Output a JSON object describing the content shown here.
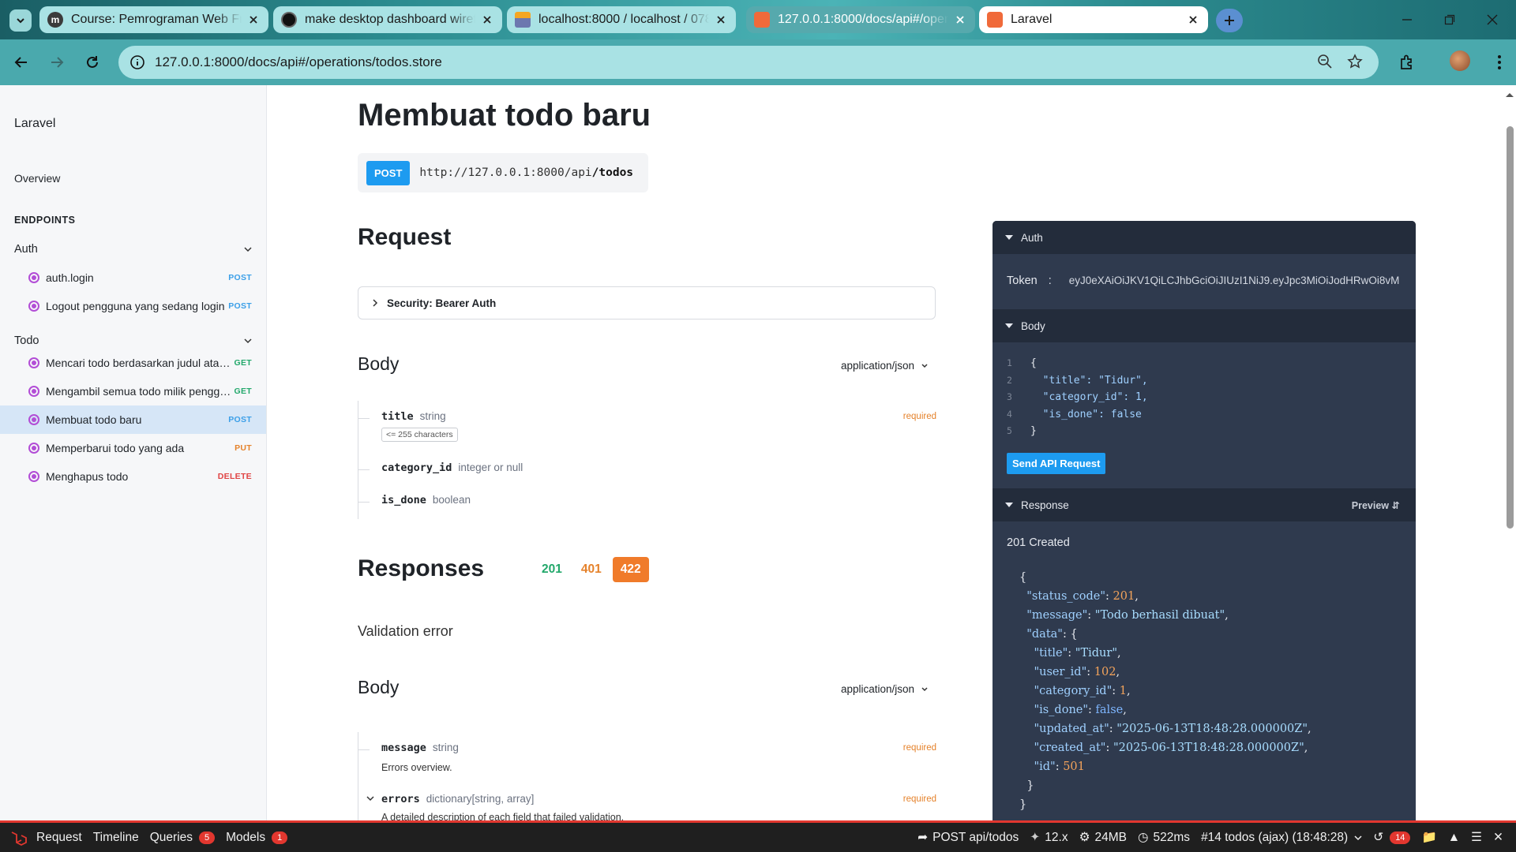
{
  "browser": {
    "tabs": [
      {
        "title": "Course: Pemrograman Web Fra",
        "favicon": "moodle-icon"
      },
      {
        "title": "make desktop dashboard wiref",
        "favicon": "chatgpt-icon"
      },
      {
        "title": "localhost:8000 / localhost / 078",
        "favicon": "phpmyadmin-icon"
      },
      {
        "title": "127.0.0.1:8000/docs/api#/opera",
        "favicon": "laravel-icon"
      },
      {
        "title": "Laravel",
        "favicon": "laravel-icon"
      }
    ],
    "url": "127.0.0.1:8000/docs/api#/operations/todos.store"
  },
  "sidebar": {
    "brand": "Laravel",
    "overview": "Overview",
    "endpoints_heading": "ENDPOINTS",
    "groups": [
      {
        "name": "Auth",
        "items": [
          {
            "label": "auth.login",
            "method": "POST"
          },
          {
            "label": "Logout pengguna yang sedang login",
            "method": "POST"
          }
        ]
      },
      {
        "name": "Todo",
        "items": [
          {
            "label": "Mencari todo berdasarkan judul atau ...",
            "method": "GET"
          },
          {
            "label": "Mengambil semua todo milik penggu...",
            "method": "GET"
          },
          {
            "label": "Membuat todo baru",
            "method": "POST"
          },
          {
            "label": "Memperbarui todo yang ada",
            "method": "PUT"
          },
          {
            "label": "Menghapus todo",
            "method": "DELETE"
          }
        ]
      }
    ]
  },
  "main": {
    "title": "Membuat todo baru",
    "method": "POST",
    "url_base": "http://127.0.0.1:8000/api",
    "url_path": "/todos",
    "request_heading": "Request",
    "security": "Security: Bearer Auth",
    "body_heading": "Body",
    "content_type": "application/json",
    "request_fields": [
      {
        "name": "title",
        "type": "string",
        "required": "required",
        "constraint": "<= 255 characters"
      },
      {
        "name": "category_id",
        "type": "integer or null"
      },
      {
        "name": "is_done",
        "type": "boolean"
      }
    ],
    "responses_heading": "Responses",
    "response_codes": [
      "201",
      "401",
      "422"
    ],
    "response_desc": "Validation error",
    "response_body_heading": "Body",
    "response_content_type": "application/json",
    "response_fields": [
      {
        "name": "message",
        "type": "string",
        "required": "required",
        "desc": "Errors overview."
      },
      {
        "name": "errors",
        "type": "dictionary[string, array]",
        "required": "required",
        "desc": "A detailed description of each field that failed validation."
      }
    ]
  },
  "panel": {
    "auth_label": "Auth",
    "token_label": "Token",
    "token_value": "eyJ0eXAiOiJKV1QiLCJhbGciOiJIUzI1NiJ9.eyJpc3MiOiJodHRwOi8vM",
    "body_label": "Body",
    "body_lines": [
      "{",
      "\"title\": \"Tidur\",",
      "\"category_id\": 1,",
      "\"is_done\": false",
      "}"
    ],
    "send_button": "Send API Request",
    "response_label": "Response",
    "preview_label": "Preview",
    "status": "201 Created",
    "response_json": {
      "status_code": "201",
      "message": "\"Todo berhasil dibuat\"",
      "title": "\"Tidur\"",
      "user_id": "102",
      "category_id": "1",
      "is_done": "false",
      "updated_at": "\"2025-06-13T18:48:28.000000Z\"",
      "created_at": "\"2025-06-13T18:48:28.000000Z\"",
      "id": "501"
    }
  },
  "debugbar": {
    "request": "Request",
    "timeline": "Timeline",
    "queries": "Queries",
    "queries_count": "5",
    "models": "Models",
    "models_count": "1",
    "route": "POST api/todos",
    "laravel_version": "12.x",
    "memory": "24MB",
    "time": "522ms",
    "request_info": "#14 todos (ajax) (18:48:28)",
    "history_count": "14"
  }
}
